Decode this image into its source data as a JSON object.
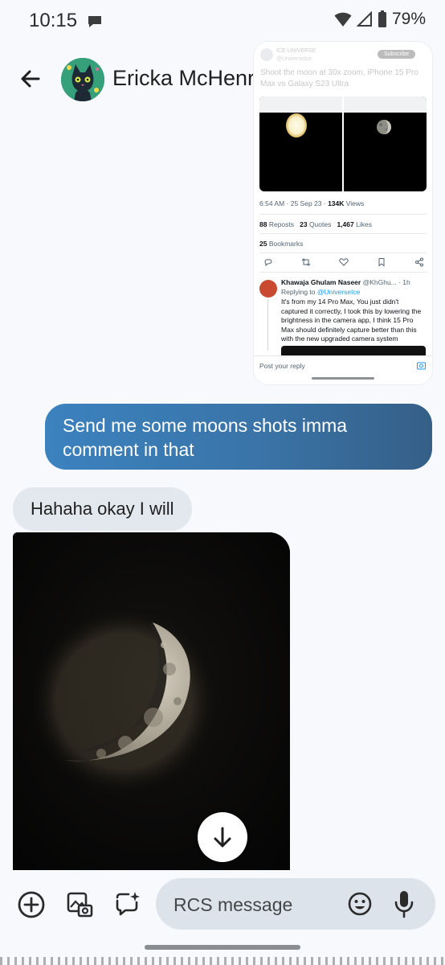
{
  "status_bar": {
    "time": "10:15",
    "battery": "79%"
  },
  "header": {
    "contact_name": "Ericka McHenry",
    "icons": [
      "arrow-back-icon",
      "avatar",
      "video-call-icon",
      "phone-icon",
      "more-vert-icon"
    ]
  },
  "tweet_screenshot": {
    "author": "ICE UNIVERSE",
    "handle": "@UniverseIce",
    "subscribe": "Subscribe",
    "text": "Shoot the moon at 30x zoom, iPhone 15 Pro Max vs Galaxy S23 Ultra",
    "meta_time": "6:54 AM · 25 Sep 23 · ",
    "meta_views": "134K",
    "meta_views_label": " Views",
    "reposts": "88",
    "reposts_label": " Reposts",
    "quotes": "23",
    "quotes_label": " Quotes",
    "likes": "1,467",
    "likes_label": " Likes",
    "bookmarks": "25",
    "bookmarks_label": " Bookmarks",
    "reply_author": "Khawaja Ghulam Naseer",
    "reply_handle": " @KhGhu... · 1h",
    "replying_to_label": "Replying to ",
    "replying_to_handle": "@UniverseIce",
    "reply_text": "It's from my 14 Pro Max, You just didn't captured it correctly, I took this by lowering the brightness in the camera app, I think 15 Pro Max should definitely capture better than this with the new upgraded camera system",
    "post_reply_placeholder": "Post your reply"
  },
  "messages": {
    "outgoing_text": "Send me some moons shots imma comment in that",
    "incoming_text": "Hahaha okay I will"
  },
  "compose": {
    "placeholder": "RCS message",
    "icons": [
      "add-icon",
      "gallery-icon",
      "magic-compose-icon",
      "emoji-icon",
      "mic-icon"
    ]
  },
  "colors": {
    "outgoing_bubble": "#3a74a8",
    "incoming_bubble": "#e3e8ee",
    "background": "#f7f9fc",
    "compose_pill": "#dde3ea"
  }
}
